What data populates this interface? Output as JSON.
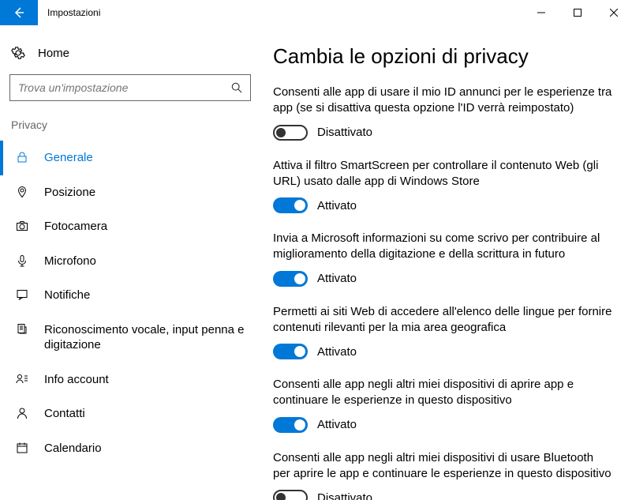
{
  "window": {
    "title": "Impostazioni"
  },
  "sidebar": {
    "home": "Home",
    "search_placeholder": "Trova un'impostazione",
    "section": "Privacy",
    "items": [
      {
        "label": "Generale",
        "active": true,
        "icon": "lock-icon"
      },
      {
        "label": "Posizione",
        "active": false,
        "icon": "location-icon"
      },
      {
        "label": "Fotocamera",
        "active": false,
        "icon": "camera-icon"
      },
      {
        "label": "Microfono",
        "active": false,
        "icon": "microphone-icon"
      },
      {
        "label": "Notifiche",
        "active": false,
        "icon": "notifications-icon"
      },
      {
        "label": "Riconoscimento vocale, input penna e digitazione",
        "active": false,
        "icon": "speech-icon"
      },
      {
        "label": "Info account",
        "active": false,
        "icon": "account-info-icon"
      },
      {
        "label": "Contatti",
        "active": false,
        "icon": "contacts-icon"
      },
      {
        "label": "Calendario",
        "active": false,
        "icon": "calendar-icon"
      }
    ]
  },
  "main": {
    "heading": "Cambia le opzioni di privacy",
    "settings": [
      {
        "desc": "Consenti alle app di usare il mio ID annunci per le esperienze tra app (se si disattiva questa opzione l'ID verrà reimpostato)",
        "on": false,
        "state": "Disattivato"
      },
      {
        "desc": "Attiva il filtro SmartScreen per controllare il contenuto Web (gli URL) usato dalle app di Windows Store",
        "on": true,
        "state": "Attivato"
      },
      {
        "desc": "Invia a Microsoft informazioni su come scrivo per contribuire al miglioramento della digitazione e della scrittura in futuro",
        "on": true,
        "state": "Attivato"
      },
      {
        "desc": "Permetti ai siti Web di accedere all'elenco delle lingue per fornire contenuti rilevanti per la mia area geografica",
        "on": true,
        "state": "Attivato"
      },
      {
        "desc": "Consenti alle app negli altri miei dispositivi di aprire app e continuare le esperienze in questo dispositivo",
        "on": true,
        "state": "Attivato"
      },
      {
        "desc": "Consenti alle app negli altri miei dispositivi di usare Bluetooth per aprire le app e continuare le esperienze in questo dispositivo",
        "on": false,
        "state": "Disattivato"
      }
    ]
  }
}
